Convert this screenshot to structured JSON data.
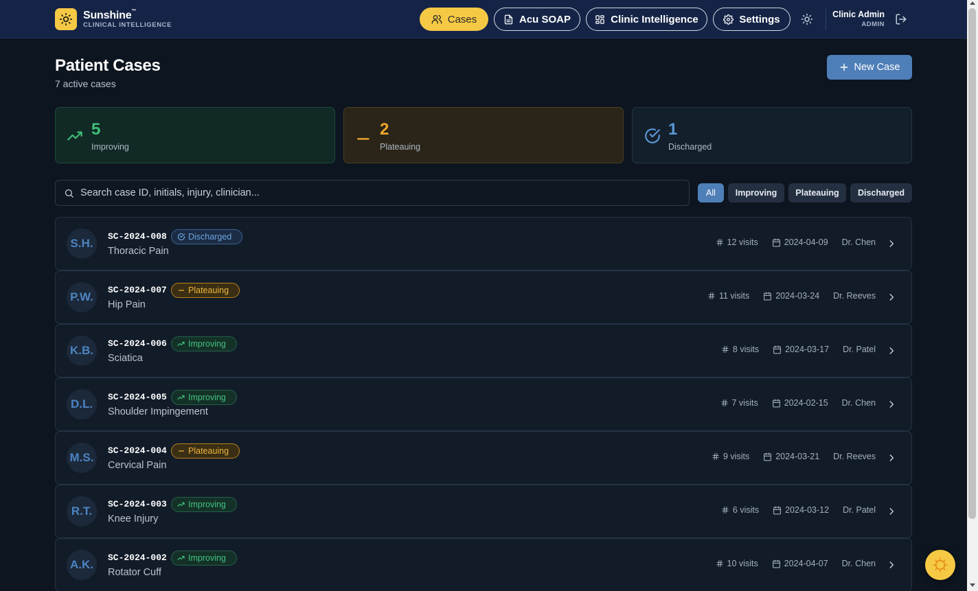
{
  "brand": {
    "name": "Sunshine",
    "tm": "™",
    "subtitle": "CLINICAL INTELLIGENCE"
  },
  "nav": {
    "cases": "Cases",
    "soap": "Acu SOAP",
    "intelligence": "Clinic Intelligence",
    "settings": "Settings"
  },
  "user": {
    "name": "Clinic Admin",
    "role": "ADMIN"
  },
  "page": {
    "title": "Patient Cases",
    "subtitle": "7 active cases",
    "new_case": "New Case"
  },
  "stats": [
    {
      "value": "5",
      "label": "Improving"
    },
    {
      "value": "2",
      "label": "Plateauing"
    },
    {
      "value": "1",
      "label": "Discharged"
    }
  ],
  "search": {
    "placeholder": "Search case ID, initials, injury, clinician..."
  },
  "filters": [
    "All",
    "Improving",
    "Plateauing",
    "Discharged"
  ],
  "cases": [
    {
      "initials": "S.H.",
      "id": "SC-2024-008",
      "status": "Discharged",
      "injury": "Thoracic Pain",
      "visits": "12 visits",
      "date": "2024-04-09",
      "clinician": "Dr. Chen"
    },
    {
      "initials": "P.W.",
      "id": "SC-2024-007",
      "status": "Plateauing",
      "injury": "Hip Pain",
      "visits": "11 visits",
      "date": "2024-03-24",
      "clinician": "Dr. Reeves"
    },
    {
      "initials": "K.B.",
      "id": "SC-2024-006",
      "status": "Improving",
      "injury": "Sciatica",
      "visits": "8 visits",
      "date": "2024-03-17",
      "clinician": "Dr. Patel"
    },
    {
      "initials": "D.L.",
      "id": "SC-2024-005",
      "status": "Improving",
      "injury": "Shoulder Impingement",
      "visits": "7 visits",
      "date": "2024-02-15",
      "clinician": "Dr. Chen"
    },
    {
      "initials": "M.S.",
      "id": "SC-2024-004",
      "status": "Plateauing",
      "injury": "Cervical Pain",
      "visits": "9 visits",
      "date": "2024-03-21",
      "clinician": "Dr. Reeves"
    },
    {
      "initials": "R.T.",
      "id": "SC-2024-003",
      "status": "Improving",
      "injury": "Knee Injury",
      "visits": "6 visits",
      "date": "2024-03-12",
      "clinician": "Dr. Patel"
    },
    {
      "initials": "A.K.",
      "id": "SC-2024-002",
      "status": "Improving",
      "injury": "Rotator Cuff",
      "visits": "10 visits",
      "date": "2024-04-07",
      "clinician": "Dr. Chen"
    }
  ],
  "colors": {
    "brand_yellow": "#f6c945",
    "accent_blue": "#4f7fb8",
    "improving": "#43c17e",
    "plateauing": "#f0b53a",
    "discharged": "#6aa3de"
  }
}
